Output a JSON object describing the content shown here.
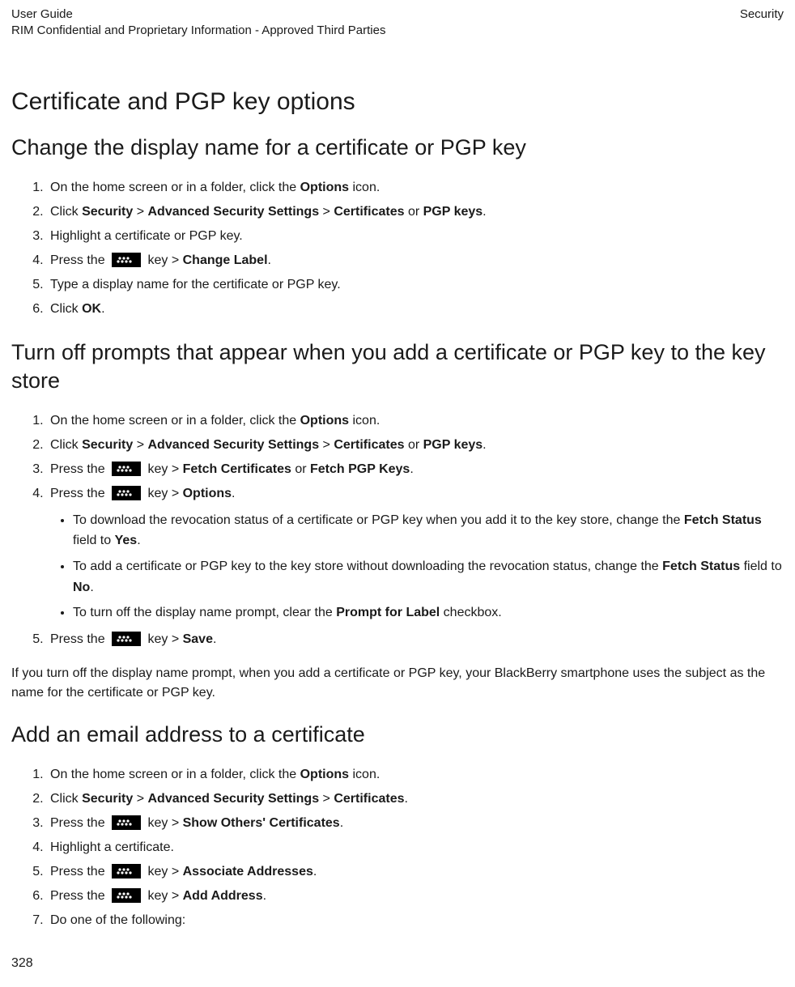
{
  "header": {
    "left_line1": "User Guide",
    "left_line2": "RIM Confidential and Proprietary Information - Approved Third Parties",
    "right": "Security"
  },
  "title": "Certificate and PGP key options",
  "s1": {
    "heading": "Change the display name for a certificate or PGP key",
    "steps": {
      "1_a": "On the home screen or in a folder, click the ",
      "1_b": "Options",
      "1_c": " icon.",
      "2_a": "Click ",
      "2_b": "Security",
      "2_c": " > ",
      "2_d": "Advanced Security Settings",
      "2_e": " > ",
      "2_f": "Certificates",
      "2_g": " or ",
      "2_h": "PGP keys",
      "2_i": ".",
      "3": "Highlight a certificate or PGP key.",
      "4_a": "Press the ",
      "4_b": " key > ",
      "4_c": "Change Label",
      "4_d": ".",
      "5": "Type a display name for the certificate or PGP key.",
      "6_a": "Click ",
      "6_b": "OK",
      "6_c": "."
    }
  },
  "s2": {
    "heading": "Turn off prompts that appear when you add a certificate or PGP key to the key store",
    "steps": {
      "1_a": "On the home screen or in a folder, click the ",
      "1_b": "Options",
      "1_c": " icon.",
      "2_a": "Click ",
      "2_b": "Security",
      "2_c": " > ",
      "2_d": "Advanced Security Settings",
      "2_e": " > ",
      "2_f": "Certificates",
      "2_g": " or ",
      "2_h": "PGP keys",
      "2_i": ".",
      "3_a": "Press the ",
      "3_b": " key > ",
      "3_c": "Fetch Certificates",
      "3_d": " or ",
      "3_e": "Fetch PGP Keys",
      "3_f": ".",
      "4_a": "Press the ",
      "4_b": " key > ",
      "4_c": "Options",
      "4_d": ".",
      "b1_a": "To download the revocation status of a certificate or PGP key when you add it to the key store, change the ",
      "b1_b": "Fetch Status",
      "b1_c": " field to ",
      "b1_d": "Yes",
      "b1_e": ".",
      "b2_a": "To add a certificate or PGP key to the key store without downloading the revocation status, change the ",
      "b2_b": "Fetch Status",
      "b2_c": " field to ",
      "b2_d": "No",
      "b2_e": ".",
      "b3_a": "To turn off the display name prompt, clear the ",
      "b3_b": "Prompt for Label",
      "b3_c": " checkbox.",
      "5_a": "Press the ",
      "5_b": " key > ",
      "5_c": "Save",
      "5_d": "."
    },
    "note": "If you turn off the display name prompt, when you add a certificate or PGP key, your BlackBerry smartphone uses the subject as the name for the certificate or PGP key."
  },
  "s3": {
    "heading": "Add an email address to a certificate",
    "steps": {
      "1_a": "On the home screen or in a folder, click the ",
      "1_b": "Options",
      "1_c": " icon.",
      "2_a": "Click ",
      "2_b": "Security",
      "2_c": " > ",
      "2_d": "Advanced Security Settings",
      "2_e": " > ",
      "2_f": "Certificates",
      "2_g": ".",
      "3_a": "Press the ",
      "3_b": " key > ",
      "3_c": "Show Others' Certificates",
      "3_d": ".",
      "4": "Highlight a certificate.",
      "5_a": "Press the ",
      "5_b": " key > ",
      "5_c": "Associate Addresses",
      "5_d": ".",
      "6_a": "Press the ",
      "6_b": " key > ",
      "6_c": "Add Address",
      "6_d": ".",
      "7": "Do one of the following:"
    }
  },
  "page_number": "328"
}
